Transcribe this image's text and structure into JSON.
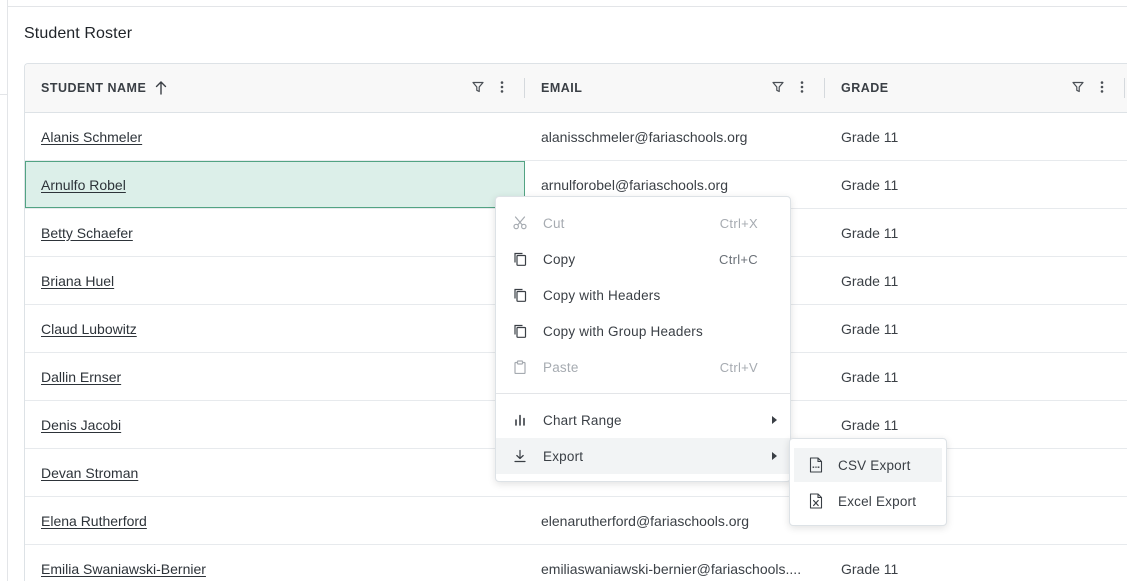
{
  "page": {
    "title": "Student Roster"
  },
  "grid": {
    "columns": [
      {
        "label": "STUDENT NAME",
        "sorted": "asc"
      },
      {
        "label": "EMAIL"
      },
      {
        "label": "GRADE"
      }
    ],
    "rows": [
      {
        "name": "Alanis Schmeler",
        "email": "alanisschmeler@fariaschools.org",
        "grade": "Grade 11"
      },
      {
        "name": "Arnulfo Robel",
        "email": "arnulforobel@fariaschools.org",
        "grade": "Grade 11"
      },
      {
        "name": "Betty Schaefer",
        "email": "",
        "grade": "Grade 11"
      },
      {
        "name": "Briana Huel",
        "email": "",
        "grade": "Grade 11"
      },
      {
        "name": "Claud Lubowitz",
        "email": "",
        "grade": "Grade 11"
      },
      {
        "name": "Dallin Ernser",
        "email": "",
        "grade": "Grade 11"
      },
      {
        "name": "Denis Jacobi",
        "email": "",
        "grade": "Grade 11"
      },
      {
        "name": "Devan Stroman",
        "email": "",
        "grade": ""
      },
      {
        "name": "Elena Rutherford",
        "email": "elenarutherford@fariaschools.org",
        "grade": ""
      },
      {
        "name": "Emilia Swaniawski-Bernier",
        "email": "emiliaswaniawski-bernier@fariaschools....",
        "grade": "Grade 11"
      }
    ],
    "selected_row": 1
  },
  "context_menu": {
    "items": [
      {
        "label": "Cut",
        "shortcut": "Ctrl+X",
        "icon": "scissors-icon",
        "disabled": true
      },
      {
        "label": "Copy",
        "shortcut": "Ctrl+C",
        "icon": "copy-icon",
        "disabled": false
      },
      {
        "label": "Copy with Headers",
        "shortcut": "",
        "icon": "copy-icon",
        "disabled": false
      },
      {
        "label": "Copy with Group Headers",
        "shortcut": "",
        "icon": "copy-icon",
        "disabled": false
      },
      {
        "label": "Paste",
        "shortcut": "Ctrl+V",
        "icon": "clipboard-icon",
        "disabled": true
      },
      {
        "label": "Chart Range",
        "shortcut": "",
        "icon": "bar-chart-icon",
        "has_submenu": true
      },
      {
        "label": "Export",
        "shortcut": "",
        "icon": "download-icon",
        "has_submenu": true,
        "active": true
      }
    ]
  },
  "export_submenu": {
    "items": [
      {
        "label": "CSV Export",
        "icon": "csv-file-icon",
        "active": true
      },
      {
        "label": "Excel Export",
        "icon": "excel-file-icon",
        "active": false
      }
    ]
  },
  "colors": {
    "selection_fill": "#dcefe9",
    "selection_border": "#52a383",
    "header_bg": "#f8f8f8",
    "menu_hover": "#f2f4f5"
  }
}
